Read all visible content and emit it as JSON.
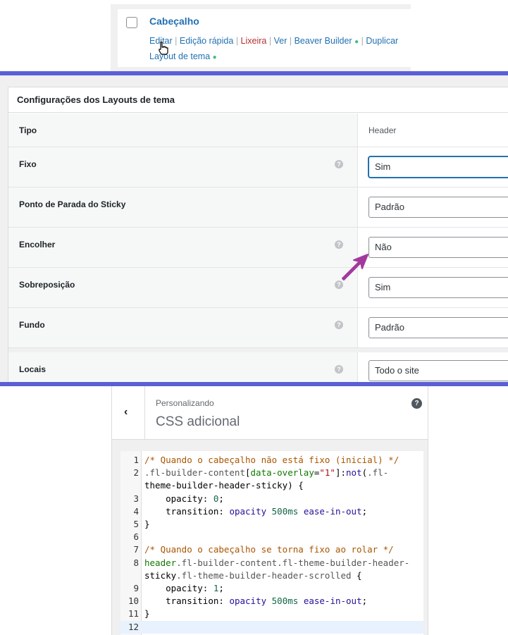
{
  "post_row": {
    "title": "Cabeçalho",
    "actions": {
      "edit": "Editar",
      "quick_edit": "Edição rápida",
      "trash": "Lixeira",
      "view": "Ver",
      "beaver_builder": "Beaver Builder",
      "duplicate": "Duplicar",
      "theme_layout": "Layout de tema",
      "separator": "|",
      "dot": "●"
    }
  },
  "settings": {
    "title": "Configurações dos Layouts de tema",
    "help_glyph": "?",
    "rows": [
      {
        "label": "Tipo",
        "value": "Header"
      },
      {
        "label": "Fixo",
        "value": "Sim"
      },
      {
        "label": "Ponto de Parada do Sticky",
        "value": "Padrão"
      },
      {
        "label": "Encolher",
        "value": "Não"
      },
      {
        "label": "Sobreposição",
        "value": "Sim"
      },
      {
        "label": "Fundo",
        "value": "Padrão"
      },
      {
        "label": "Locais",
        "value": "Todo o site"
      }
    ]
  },
  "customizer": {
    "back_glyph": "‹",
    "subtitle": "Personalizando",
    "title": "CSS adicional",
    "help_glyph": "?"
  },
  "code_editor": {
    "line_numbers": [
      "1",
      "2",
      "",
      "3",
      "4",
      "5",
      "6",
      "7",
      "8",
      "",
      "9",
      "10",
      "11",
      "12"
    ],
    "lines": [
      "/* Quando o cabeçalho não está fixo (inicial) */",
      ".fl-builder-content[data-overlay=\"1\"]:not(.fl-",
      "theme-builder-header-sticky) {",
      "    opacity: 0;",
      "    transition: opacity 500ms ease-in-out;",
      "}",
      "",
      "/* Quando o cabeçalho se torna fixo ao rolar */",
      "header.fl-builder-content.fl-theme-builder-header-",
      "sticky.fl-theme-builder-header-scrolled {",
      "    opacity: 1;",
      "    transition: opacity 500ms ease-in-out;",
      "}",
      ""
    ]
  },
  "colors": {
    "link": "#2271b1",
    "trash": "#b32d2e",
    "divider": "#5b5fd6",
    "annotation_arrow": "#a23a9e",
    "active_line": "#e8f2ff"
  }
}
